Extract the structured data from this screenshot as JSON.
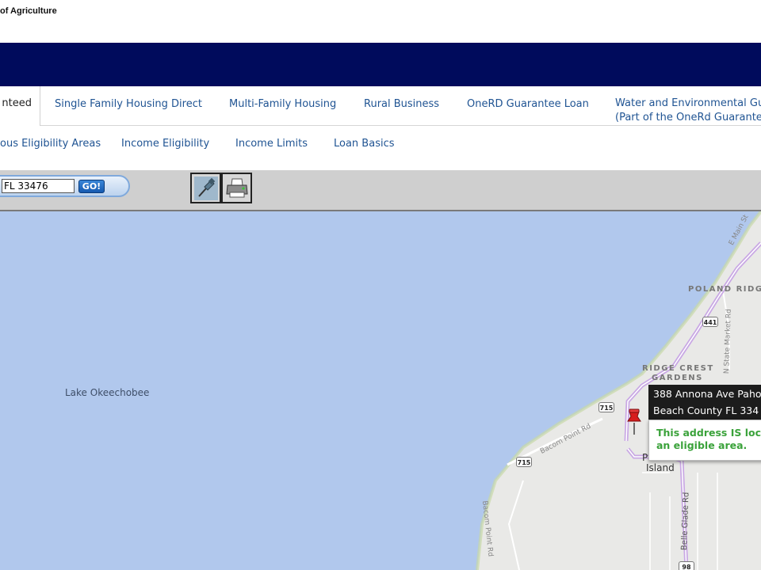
{
  "header": {
    "agency_text": "of Agriculture"
  },
  "nav": {
    "tabs": [
      {
        "label": "nteed",
        "active": true
      },
      {
        "label": "Single Family Housing Direct"
      },
      {
        "label": "Multi-Family Housing"
      },
      {
        "label": "Rural Business"
      },
      {
        "label": "OneRD Guarantee Loan"
      },
      {
        "label_line1": "Water and Environmental Gu",
        "label_line2": "(Part of the OneRd Guarantee"
      }
    ],
    "subtabs": [
      {
        "label": "ous Eligibility Areas"
      },
      {
        "label": "Income Eligibility"
      },
      {
        "label": "Income Limits"
      },
      {
        "label": "Loan Basics"
      }
    ]
  },
  "toolbar": {
    "search_value": "FL 33476",
    "go_label": "GO!",
    "tools": [
      "pushpin-icon",
      "printer-icon"
    ]
  },
  "map": {
    "lake_label": "Lake Okeechobee",
    "places": [
      "POLAND RIDG",
      "RIDGE CREST",
      "GARDENS"
    ],
    "island_label": "Island",
    "island_prefix": "P",
    "roads": [
      "E Main St",
      "N State Market Rd",
      "Bacom Point Rd",
      "Bacom Point Rd",
      "Belle Glade Rd"
    ],
    "shields": [
      "441",
      "715",
      "715",
      "98"
    ],
    "callout": {
      "address_line1": "388 Annona Ave Paho",
      "address_line2": "Beach County FL 334",
      "status_line1": "This address IS loc",
      "status_line2": "an eligible area."
    },
    "colors": {
      "water": "#b1c8ed",
      "land": "#e9e9e7",
      "highlight_road": "#c9a8e4",
      "status": "#3aa23a",
      "banner": "#000b5c"
    }
  }
}
